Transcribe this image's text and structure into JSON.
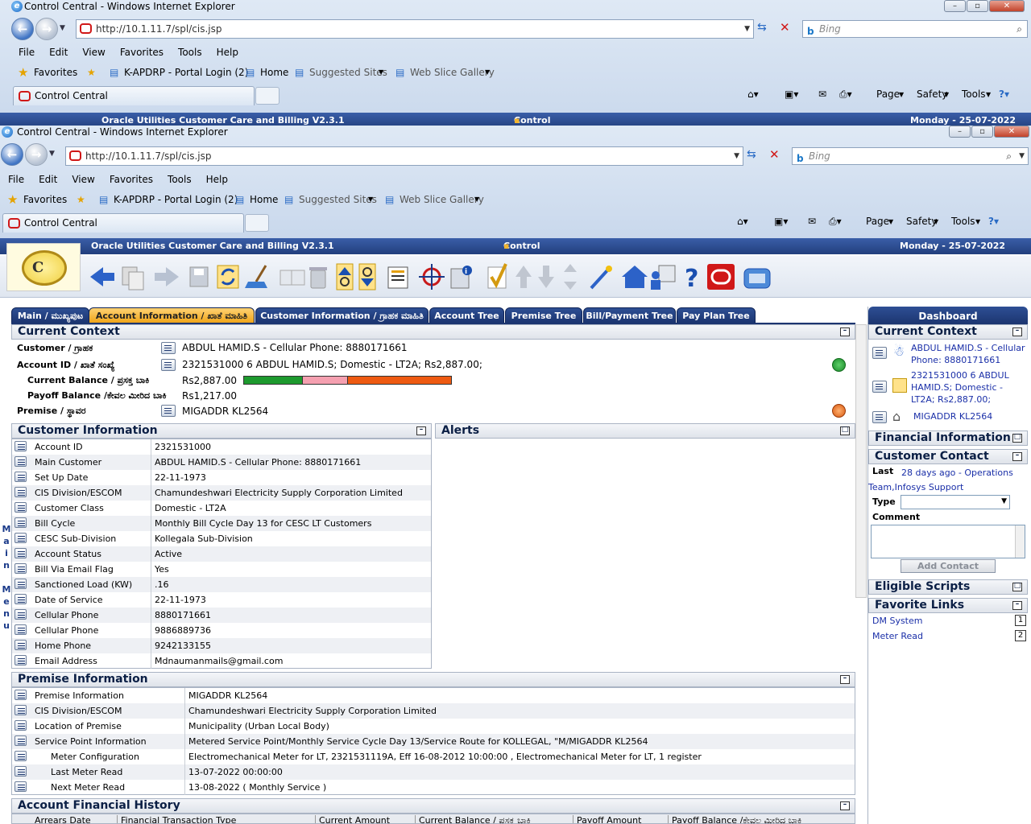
{
  "browser_back": {
    "title": "Control Central - Windows Internet Explorer",
    "url": "http://10.1.11.7/spl/cis.jsp",
    "search_placeholder": "Bing",
    "menu": [
      "File",
      "Edit",
      "View",
      "Favorites",
      "Tools",
      "Help"
    ],
    "favorites_label": "Favorites",
    "fav_items": [
      "K-APDRP - Portal Login (2)",
      "Home",
      "Suggested Sites",
      "Web Slice Gallery"
    ],
    "tab_label": "Control Central",
    "commands": [
      "Page",
      "Safety",
      "Tools"
    ],
    "header_app": "Oracle Utilities Customer Care and Billing V2.3.1",
    "header_center": "Control Central",
    "header_date": "Monday - 25-07-2022"
  },
  "browser": {
    "title": "Control Central - Windows Internet Explorer",
    "url": "http://10.1.11.7/spl/cis.jsp",
    "search_placeholder": "Bing",
    "menu": [
      "File",
      "Edit",
      "View",
      "Favorites",
      "Tools",
      "Help"
    ],
    "favorites_label": "Favorites",
    "fav_items": [
      "K-APDRP - Portal Login (2)",
      "Home",
      "Suggested Sites",
      "Web Slice Gallery"
    ],
    "tab_label": "Control Central",
    "commands": [
      "Page",
      "Safety",
      "Tools"
    ]
  },
  "app_header": {
    "app": "Oracle Utilities Customer Care and Billing V2.3.1",
    "center": "Control Central",
    "date": "Monday - 25-07-2022"
  },
  "tabs": [
    "Main / ಮುಖ್ಯಪುಟ",
    "Account Information / ಖಾತೆ ಮಾಹಿತಿ",
    "Customer Information / ಗ್ರಾಹಕ ಮಾಹಿತಿ",
    "Account Tree",
    "Premise Tree",
    "Bill/Payment Tree",
    "Pay Plan Tree"
  ],
  "current_context": {
    "title": "Current Context",
    "customer_label": "Customer / ಗ್ರಾಹಕ",
    "customer_value": "ABDUL HAMID.S - Cellular Phone: 8880171661",
    "account_label": "Account ID / ಖಾತೆ ಸಂಖ್ಯೆ",
    "account_value": "2321531000 6 ABDUL HAMID.S; Domestic - LT2A; Rs2,887.00;",
    "current_balance_label": "Current Balance / ಪ್ರಸಕ್ತ ಬಾಕಿ",
    "current_balance_value": "Rs2,887.00",
    "payoff_label": "Payoff Balance /ಕೇವಲ ಮೀರಿದ ಬಾಕಿ",
    "payoff_value": "Rs1,217.00",
    "premise_label": "Premise / ಸ್ಥಾವರ",
    "premise_value": "MIGADDR KL2564"
  },
  "customer_info": {
    "title": "Customer Information",
    "rows": [
      [
        "Account ID",
        "2321531000"
      ],
      [
        "Main Customer",
        "ABDUL HAMID.S - Cellular Phone: 8880171661"
      ],
      [
        "Set Up Date",
        "22-11-1973"
      ],
      [
        "CIS Division/ESCOM",
        "Chamundeshwari Electricity Supply Corporation Limited"
      ],
      [
        "Customer Class",
        "Domestic - LT2A"
      ],
      [
        "Bill Cycle",
        "Monthly Bill Cycle Day 13 for CESC LT Customers"
      ],
      [
        "CESC Sub-Division",
        "Kollegala Sub-Division"
      ],
      [
        "Account Status",
        "Active"
      ],
      [
        "Bill Via Email Flag",
        "Yes"
      ],
      [
        "Sanctioned Load (KW)",
        ".16"
      ],
      [
        "Date of Service",
        "22-11-1973"
      ],
      [
        "Cellular Phone",
        "8880171661"
      ],
      [
        "Cellular Phone",
        "9886889736"
      ],
      [
        "Home Phone",
        "9242133155"
      ],
      [
        "Email Address",
        "Mdnaumanmails@gmail.com"
      ]
    ]
  },
  "alerts": {
    "title": "Alerts"
  },
  "premise_info": {
    "title": "Premise Information",
    "rows": [
      [
        "Premise Information",
        "MIGADDR KL2564"
      ],
      [
        "CIS Division/ESCOM",
        "Chamundeshwari Electricity Supply Corporation Limited"
      ],
      [
        "Location of Premise",
        "Municipality (Urban Local Body)"
      ],
      [
        "Service Point Information",
        "Metered Service Point/Monthly Service Cycle Day 13/Service Route for KOLLEGAL, \"M/MIGADDR KL2564"
      ],
      [
        "Meter Configuration",
        "Electromechanical Meter for LT, 2321531119A, Eff 16-08-2012 10:00:00 , Electromechanical Meter for LT, 1 register"
      ],
      [
        "Last Meter Read",
        "13-07-2022 00:00:00"
      ],
      [
        "Next Meter Read",
        "13-08-2022 ( Monthly Service )"
      ]
    ]
  },
  "financial_history": {
    "title": "Account Financial History",
    "columns": [
      "Arrears Date",
      "Financial Transaction Type",
      "Current Amount",
      "Current Balance / ಪ್ರಸಕ್ತ ಬಾಕಿ",
      "Payoff Amount",
      "Payoff Balance /ಕೇವಲ ಮೀರಿದ ಬಾಕಿ"
    ]
  },
  "side_menu": "Main Menu",
  "dashboard": {
    "title": "Dashboard",
    "context_title": "Current Context",
    "ctx_customer": "ABDUL HAMID.S - Cellular Phone: 8880171661",
    "ctx_account": "2321531000 6 ABDUL HAMID.S; Domestic - LT2A; Rs2,887.00;",
    "ctx_premise": "MIGADDR KL2564",
    "financial_title": "Financial Information",
    "contact_title": "Customer Contact",
    "last_label": "Last",
    "last_value": "28 days ago - Operations Team,Infosys Support",
    "type_label": "Type",
    "comment_label": "Comment",
    "add_contact": "Add Contact",
    "scripts_title": "Eligible Scripts",
    "links_title": "Favorite Links",
    "links": [
      [
        "DM System",
        "1"
      ],
      [
        "Meter Read",
        "2"
      ]
    ]
  },
  "balance_bar": [
    {
      "color": "#1d9a2e",
      "fraction": 0.28
    },
    {
      "color": "#f5a0b0",
      "fraction": 0.22
    },
    {
      "color": "#ee5a12",
      "fraction": 0.5
    }
  ],
  "colors": {
    "header": "#223f7d",
    "active_tab": "#f0a51a",
    "link": "#1a2fa8"
  }
}
